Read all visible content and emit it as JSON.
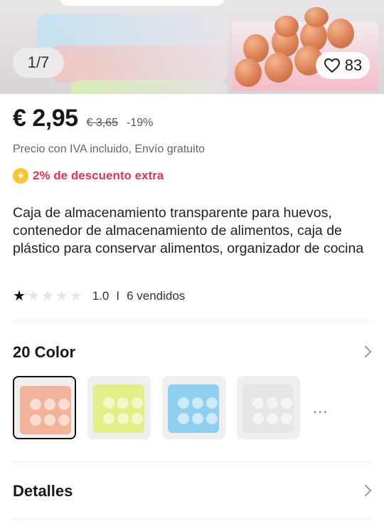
{
  "gallery": {
    "page_indicator": "1/7",
    "favorites_count": "83"
  },
  "price": {
    "current": "€ 2,95",
    "original": "€ 3,65",
    "discount": "-19%",
    "tax_note": "Precio con IVA incluido, Envío gratuito",
    "extra_discount": "2% de descuento extra",
    "accent_color": "#e8344e"
  },
  "product": {
    "title": "Caja de almacenamiento transparente para huevos, contenedor de almacenamiento de alimentos, caja de plástico para conservar alimentos, organizador de cocina",
    "rating_value": "1.0",
    "rating_stars": 1,
    "rating_max": 5,
    "sold": "6 vendidos"
  },
  "color_section": {
    "title": "20 Color",
    "swatches": [
      {
        "name": "orange",
        "color": "#f3b39a",
        "selected": true
      },
      {
        "name": "yellow-green",
        "color": "#e3ef86",
        "selected": false
      },
      {
        "name": "blue",
        "color": "#8fd0f0",
        "selected": false
      },
      {
        "name": "clear",
        "color": "#e6e6e8",
        "selected": false
      }
    ],
    "more": "..."
  },
  "details_section": {
    "title": "Detalles"
  }
}
